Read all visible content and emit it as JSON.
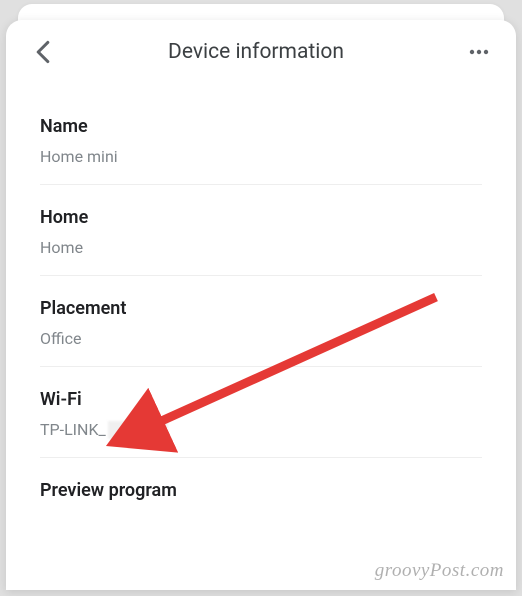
{
  "header": {
    "title": "Device information"
  },
  "sections": {
    "name": {
      "label": "Name",
      "value": "Home mini"
    },
    "home": {
      "label": "Home",
      "value": "Home"
    },
    "placement": {
      "label": "Placement",
      "value": "Office"
    },
    "wifi": {
      "label": "Wi-Fi",
      "value": "TP-LINK_"
    },
    "preview": {
      "label": "Preview program"
    }
  },
  "watermark": "groovyPost.com"
}
